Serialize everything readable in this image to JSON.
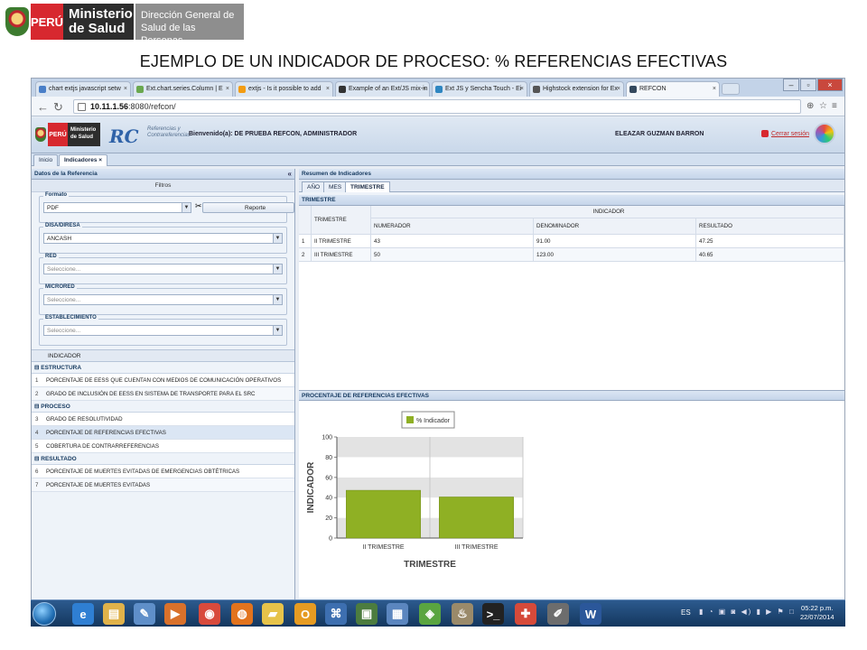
{
  "slide": {
    "peru_label": "PERÚ",
    "ministerio_label": "Ministerio de Salud",
    "direccion_label": "Dirección General de Salud de las Personas",
    "title": "EJEMPLO DE UN INDICADOR DE PROCESO:  % REFERENCIAS EFECTIVAS"
  },
  "browser": {
    "tabs": [
      {
        "label": "chart extjs javascript setw",
        "icon_color": "#4a7fc8"
      },
      {
        "label": "Ext.chart.series.Column | E",
        "icon_color": "#6aa84f"
      },
      {
        "label": "extjs - Is it possible to add",
        "icon_color": "#f39c12"
      },
      {
        "label": "Example of an Ext/JS mix-in",
        "icon_color": "#333333"
      },
      {
        "label": "Ext JS y Sencha Touch - Ei",
        "icon_color": "#2e86c1"
      },
      {
        "label": "Highstock extension for Ex",
        "icon_color": "#555555"
      },
      {
        "label": "REFCON",
        "icon_color": "#34495e"
      }
    ],
    "tab_close_glyph": "×",
    "window_buttons": [
      "–",
      "▫",
      "×"
    ],
    "url_host": "10.11.1.56",
    "url_rest": ":8080/refcon/",
    "url_right_icons": [
      "⊕",
      "☆",
      "≡"
    ]
  },
  "app": {
    "peru_label": "PERÚ",
    "ministerio_label": "Ministerio de Salud",
    "refcon_mark": "RC",
    "refcon_sub": "Referencias y Contrareferencias",
    "welcome": "Bienvenido(a): DE PRUEBA REFCON, ADMINISTRADOR",
    "username": "ELEAZAR GUZMAN BARRON",
    "logout": "Cerrar sesión",
    "tabs": [
      "Inicio",
      "Indicadores"
    ],
    "tab_close_glyph": "×"
  },
  "left": {
    "title": "Datos de la Referencia",
    "collapse_glyph": "«",
    "filters_label": "Filtros",
    "formato_label": "Formato",
    "formato_value": "PDF",
    "report_label": "Reporte",
    "disa_label": "DISA/DIRESA",
    "disa_value": "ANCASH",
    "red_label": "RED",
    "red_placeholder": "Seleccione...",
    "microred_label": "MICRORED",
    "microred_placeholder": "Seleccione...",
    "establecimiento_label": "ESTABLECIMIENTO",
    "establecimiento_placeholder": "Seleccione...",
    "indicator_header": "INDICADOR",
    "groups": [
      {
        "label": "⊟ ESTRUCTURA",
        "items": [
          {
            "n": "1",
            "label": "PORCENTAJE DE EESS QUE CUENTAN CON MEDIOS DE COMUNICACIÓN OPERATIVOS"
          },
          {
            "n": "2",
            "label": "GRADO DE INCLUSIÓN DE EESS EN SISTEMA DE TRANSPORTE PARA EL SRC"
          }
        ]
      },
      {
        "label": "⊟ PROCESO",
        "items": [
          {
            "n": "3",
            "label": "GRADO DE RESOLUTIVIDAD"
          },
          {
            "n": "4",
            "label": "PORCENTAJE DE REFERENCIAS EFECTIVAS"
          },
          {
            "n": "5",
            "label": "COBERTURA DE CONTRARREFERENCIAS"
          }
        ]
      },
      {
        "label": "⊟ RESULTADO",
        "items": [
          {
            "n": "6",
            "label": "PORCENTAJE DE MUERTES EVITADAS DE EMERGENCIAS OBTÉTRICAS"
          },
          {
            "n": "7",
            "label": "PORCENTAJE DE MUERTES EVITADAS"
          }
        ]
      }
    ]
  },
  "right": {
    "title": "Resumen de Indicadores",
    "period_tabs": [
      "AÑO",
      "MES",
      "TRIMESTRE"
    ],
    "grid_title": "TRIMESTRE",
    "grid": {
      "col_trimestre": "TRIMESTRE",
      "col_group": "INDICADOR",
      "columns": [
        "NUMERADOR",
        "DENOMINADOR",
        "RESULTADO"
      ],
      "rows": [
        {
          "n": "1",
          "trimestre": "II TRIMESTRE",
          "numerador": "43",
          "denominador": "91.00",
          "resultado": "47.25"
        },
        {
          "n": "2",
          "trimestre": "III TRIMESTRE",
          "numerador": "50",
          "denominador": "123.00",
          "resultado": "40.65"
        }
      ]
    },
    "chart_title": "PROCENTAJE DE REFERENCIAS EFECTIVAS"
  },
  "chart_data": {
    "type": "bar",
    "categories": [
      "II TRIMESTRE",
      "III TRIMESTRE"
    ],
    "series": [
      {
        "name": "% Indicador",
        "values": [
          47.25,
          40.65
        ]
      }
    ],
    "xlabel": "TRIMESTRE",
    "ylabel": "INDICADOR",
    "ylim": [
      0,
      100
    ],
    "yticks": [
      0,
      20,
      40,
      60,
      80,
      100
    ],
    "bar_color": "#8fb024",
    "legend_position": "top"
  },
  "taskbar": {
    "apps": [
      {
        "name": "ie-icon",
        "glyph": "e",
        "color": "#2f7fd3"
      },
      {
        "name": "explorer-icon",
        "glyph": "▤",
        "color": "#e0b24a"
      },
      {
        "name": "notes-icon",
        "glyph": "✎",
        "color": "#5f8fc9"
      },
      {
        "name": "media-icon",
        "glyph": "▶",
        "color": "#d9712b"
      },
      {
        "name": "chrome-icon",
        "glyph": "◉",
        "color": "#d84a3c"
      },
      {
        "name": "firefox-icon",
        "glyph": "◍",
        "color": "#e2731d"
      },
      {
        "name": "folder-icon",
        "glyph": "▰",
        "color": "#e6c34a"
      },
      {
        "name": "outlook-icon",
        "glyph": "O",
        "color": "#e69b22"
      },
      {
        "name": "network-icon",
        "glyph": "⌘",
        "color": "#3d6fb0"
      },
      {
        "name": "monitor-icon",
        "glyph": "▣",
        "color": "#4c7c3f"
      },
      {
        "name": "docs-icon",
        "glyph": "▦",
        "color": "#5b86bf"
      },
      {
        "name": "map-icon",
        "glyph": "◈",
        "color": "#5aa540"
      },
      {
        "name": "tool-icon",
        "glyph": "♨",
        "color": "#9a8a6a"
      },
      {
        "name": "terminal-icon",
        "glyph": ">_",
        "color": "#222222"
      },
      {
        "name": "lifebuoy-icon",
        "glyph": "✚",
        "color": "#d64a3a"
      },
      {
        "name": "painter-icon",
        "glyph": "✐",
        "color": "#6d6d6d"
      },
      {
        "name": "word-icon",
        "glyph": "W",
        "color": "#2b579a"
      }
    ],
    "lang": "ES",
    "tray": "▮ ◔ ▣ ◙ ◀) ▮ ▶ ⚑ □",
    "time": "05:22 p.m.",
    "date": "22/07/2014"
  }
}
